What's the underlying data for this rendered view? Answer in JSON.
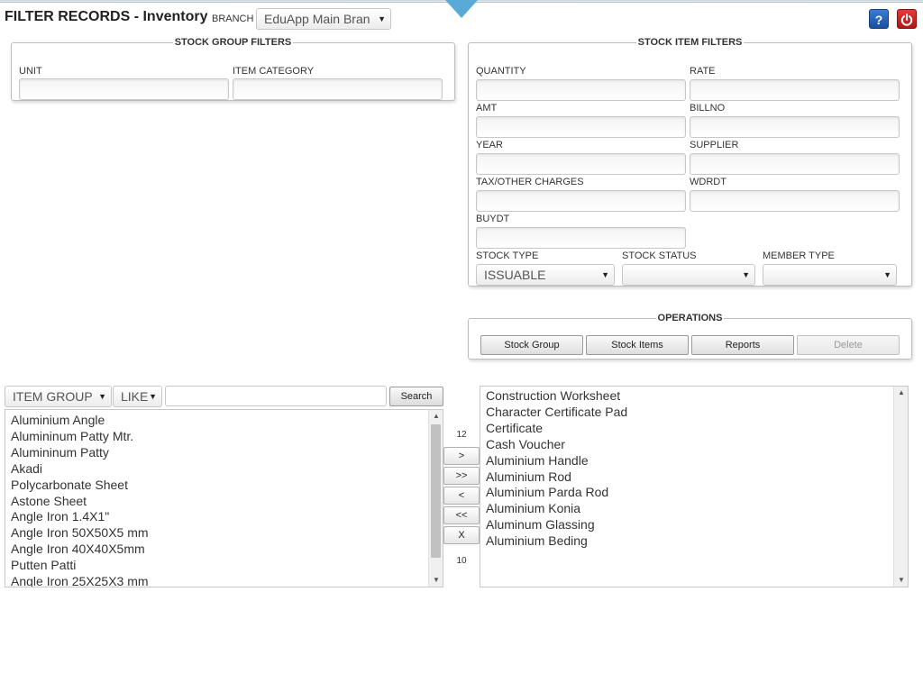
{
  "header": {
    "title": "FILTER RECORDS - Inventory",
    "branch_label": "BRANCH",
    "branch_value": "EduApp Main Bran",
    "help_label": "?"
  },
  "stock_group_filters": {
    "legend": "STOCK GROUP FILTERS",
    "unit_label": "UNIT",
    "item_category_label": "ITEM CATEGORY"
  },
  "stock_item_filters": {
    "legend": "STOCK ITEM FILTERS",
    "quantity_label": "QUANTITY",
    "rate_label": "RATE",
    "amt_label": "AMT",
    "billno_label": "BILLNO",
    "year_label": "YEAR",
    "supplier_label": "SUPPLIER",
    "tax_label": "TAX/OTHER CHARGES",
    "wdrdt_label": "WDRDT",
    "buydt_label": "BUYDT",
    "stock_type_label": "STOCK TYPE",
    "stock_type_value": "ISSUABLE",
    "stock_status_label": "STOCK STATUS",
    "stock_status_value": "",
    "member_type_label": "MEMBER TYPE",
    "member_type_value": ""
  },
  "operations": {
    "legend": "OPERATIONS",
    "stock_group": "Stock Group",
    "stock_items": "Stock Items",
    "reports": "Reports",
    "delete": "Delete"
  },
  "search": {
    "field_value": "ITEM GROUP",
    "operator_value": "LIKE",
    "button": "Search"
  },
  "left_list": {
    "count": "12",
    "items": [
      "Aluminium Angle",
      "Alumininum Patty Mtr.",
      "Alumininum Patty",
      "Akadi",
      "Polycarbonate Sheet",
      "Astone Sheet",
      "Angle Iron 1.4X1\"",
      "Angle Iron 50X50X5 mm",
      "Angle Iron 40X40X5mm",
      "Putten Patti",
      "Angle Iron 25X25X3 mm"
    ]
  },
  "move_buttons": {
    "add": ">",
    "add_all": ">>",
    "remove": "<",
    "remove_all": "<<",
    "clear": "X"
  },
  "right_list": {
    "count": "10",
    "items": [
      "Construction Worksheet",
      "Character Certificate Pad",
      "Certificate",
      "Cash Voucher",
      "Aluminium Handle",
      "Aluminium Rod",
      "Aluminium Parda Rod",
      "Aluminium Konia",
      "Aluminum Glassing",
      "Aluminium Beding"
    ]
  }
}
